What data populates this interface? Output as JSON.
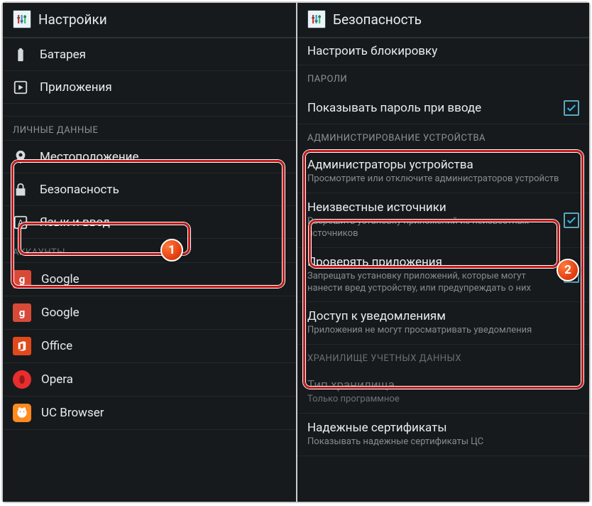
{
  "left": {
    "title": "Настройки",
    "items": {
      "battery": "Батарея",
      "apps": "Приложения"
    },
    "section_personal": "ЛИЧНЫЕ ДАННЫЕ",
    "personal": {
      "location": "Местоположение",
      "security": "Безопасность",
      "language": "Язык и ввод"
    },
    "section_accounts": "АККАУНТЫ",
    "accounts": {
      "google1": "Google",
      "google2": "Google",
      "office": "Office",
      "opera": "Opera",
      "uc": "UC Browser"
    }
  },
  "right": {
    "title": "Безопасность",
    "configure_lock": "Настроить блокировку",
    "section_passwords": "ПАРОЛИ",
    "show_password": "Показывать пароль при вводе",
    "section_admin": "АДМИНИСТРИРОВАНИЕ УСТРОЙСТВА",
    "device_admins": "Администраторы устройства",
    "device_admins_sub": "Просмотрите или отключите администраторов устройств",
    "unknown_sources": "Неизвестные источники",
    "unknown_sources_sub": "Разрешить установку приложений из неизвестных источников",
    "verify_apps": "Проверять приложения",
    "verify_apps_sub": "Запрещать установку приложений, которые могут нанести вред устройству, или предупреждать о них",
    "notif_access": "Доступ к уведомлениям",
    "notif_access_sub": "Приложения не могут просматривать уведомления",
    "section_storage": "ХРАНИЛИЩЕ УЧЕТНЫХ ДАННЫХ",
    "storage_type": "Тип хранилища",
    "storage_type_sub": "Только программное",
    "trusted_certs": "Надежные сертификаты",
    "trusted_certs_sub": "Показывать надежные сертификаты ЦС"
  },
  "badges": {
    "one": "1",
    "two": "2"
  }
}
